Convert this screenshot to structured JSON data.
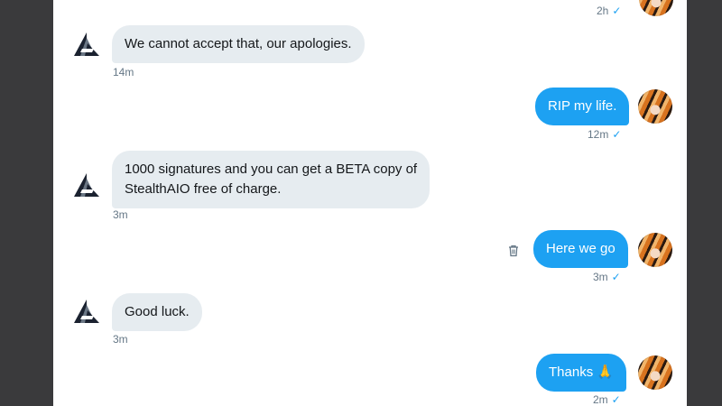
{
  "conversation": {
    "messages": [
      {
        "from": "them",
        "text": "",
        "time": "2h"
      },
      {
        "from": "them",
        "text": "We cannot accept that, our apologies.",
        "time": "14m"
      },
      {
        "from": "me",
        "text": "RIP my life.",
        "time": "12m"
      },
      {
        "from": "them",
        "line1": "1000 signatures and you can get a BETA copy of",
        "line2": "StealthAIO free of charge.",
        "time": "3m"
      },
      {
        "from": "me",
        "text": "Here we go",
        "time": "3m"
      },
      {
        "from": "them",
        "text": "Good luck.",
        "time": "3m"
      },
      {
        "from": "me",
        "text": "Thanks 🙏",
        "time": "2m"
      }
    ],
    "check_mark": "✓"
  },
  "icons": {
    "sender_avatar": "stealthaio-logo-icon",
    "user_avatar": "tiger-avatar-icon",
    "delete": "trash-icon"
  },
  "colors": {
    "outgoing_bubble": "#1da1f2",
    "incoming_bubble": "#e6ecf0",
    "timestamp": "#657786",
    "frame": "#3a3a3c"
  }
}
